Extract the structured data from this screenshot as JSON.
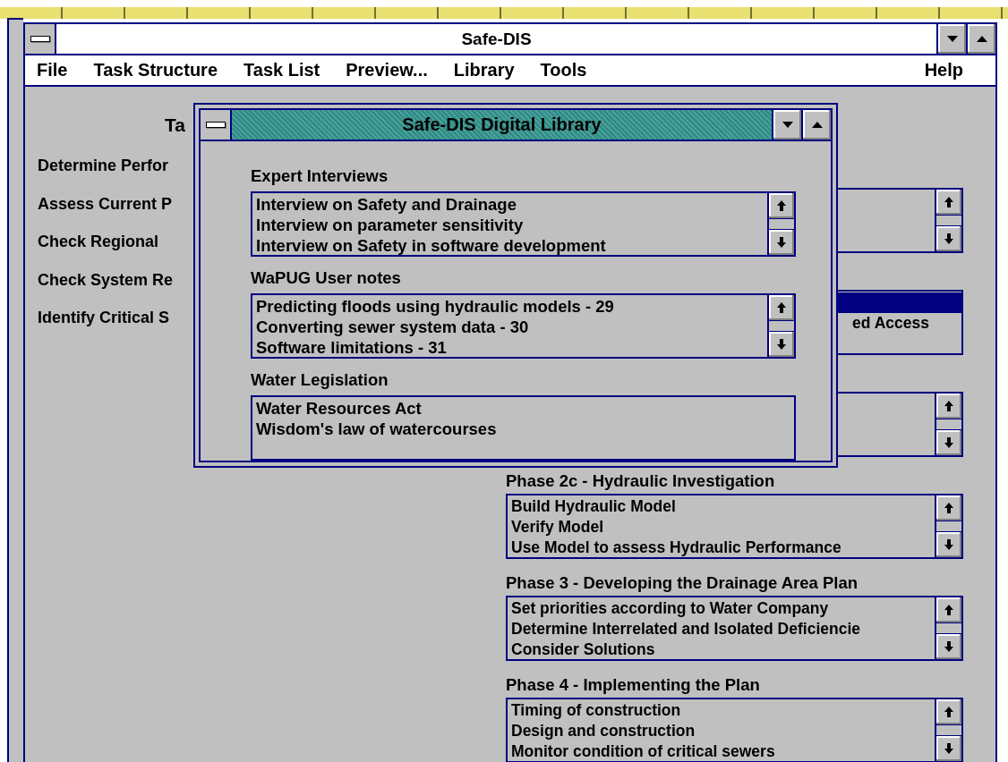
{
  "window": {
    "title": "Safe-DIS"
  },
  "menu": [
    {
      "label": "File"
    },
    {
      "label": "Task Structure"
    },
    {
      "label": "Task List"
    },
    {
      "label": "Preview..."
    },
    {
      "label": "Library"
    },
    {
      "label": "Tools"
    },
    {
      "label": "Help"
    }
  ],
  "task_panel": {
    "heading": "Ta",
    "tasks": [
      "Determine Perfor",
      "Assess Current P",
      "Check Regional",
      "Check System Re",
      "Identify Critical S"
    ]
  },
  "phase_lists": [
    {
      "scrollbar": true
    },
    {
      "scrollbar": false,
      "items": [
        {
          "selected": true
        },
        {
          "text": "ed Access",
          "selected": false
        }
      ]
    },
    {
      "scrollbar": true
    },
    {
      "heading": "Phase 2c - Hydraulic Investigation",
      "scrollbar": true,
      "items": [
        {
          "text": "Build Hydraulic Model",
          "selected": false
        },
        {
          "text": "Verify Model",
          "selected": false
        },
        {
          "text": "Use Model to assess Hydraulic Performance",
          "selected": false
        }
      ]
    },
    {
      "heading": "Phase 3 - Developing the Drainage Area Plan",
      "scrollbar": true,
      "items": [
        {
          "text": "Set priorities according to Water Company",
          "selected": false
        },
        {
          "text": "Determine Interrelated and Isolated Deficiencie",
          "selected": false
        },
        {
          "text": "Consider Solutions",
          "selected": false
        }
      ]
    },
    {
      "heading": "Phase 4 - Implementing the Plan",
      "scrollbar": true,
      "items": [
        {
          "text": "Timing of construction",
          "selected": false
        },
        {
          "text": "Design and construction",
          "selected": false
        },
        {
          "text": "Monitor condition of critical sewers",
          "selected": false
        }
      ]
    }
  ],
  "library_dialog": {
    "title": "Safe-DIS Digital Library",
    "sections": [
      {
        "heading": "Expert Interviews",
        "scrollbar": true,
        "items": [
          {
            "text": "Interview on Safety and Drainage",
            "selected": false
          },
          {
            "text": "Interview on parameter sensitivity",
            "selected": false
          },
          {
            "text": "Interview on Safety in software development",
            "selected": false
          }
        ]
      },
      {
        "heading": "WaPUG User notes",
        "scrollbar": true,
        "items": [
          {
            "text": "Predicting floods using hydraulic models - 29",
            "selected": false
          },
          {
            "text": "Converting sewer system data - 30",
            "selected": false
          },
          {
            "text": "Software limitations - 31",
            "selected": false
          }
        ]
      },
      {
        "heading": "Water Legislation",
        "scrollbar": false,
        "items": [
          {
            "text": "Water Resources Act",
            "selected": false
          },
          {
            "text": "Wisdom's law of watercourses",
            "selected": false
          }
        ]
      }
    ]
  }
}
